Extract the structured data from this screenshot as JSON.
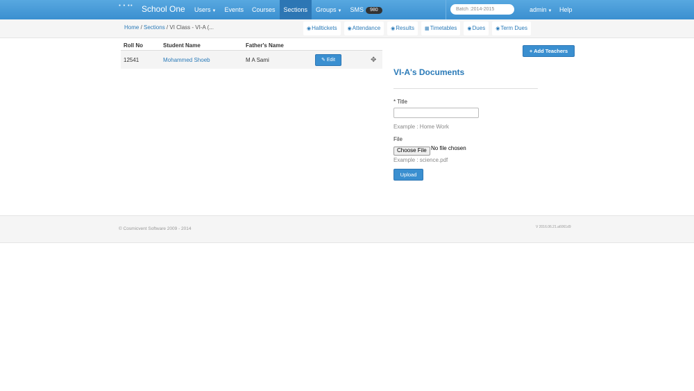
{
  "navbar": {
    "brand": "School One",
    "items": [
      {
        "label": "Users",
        "dropdown": true,
        "active": false
      },
      {
        "label": "Events",
        "dropdown": false,
        "active": false
      },
      {
        "label": "Courses",
        "dropdown": false,
        "active": false
      },
      {
        "label": "Sections",
        "dropdown": false,
        "active": true
      },
      {
        "label": "Groups",
        "dropdown": true,
        "active": false
      },
      {
        "label": "SMS",
        "dropdown": false,
        "active": false,
        "badge": "980"
      }
    ],
    "batch": "Batch :2014-2015",
    "admin": "admin",
    "help": "Help"
  },
  "breadcrumb": {
    "home": "Home",
    "sections": "Sections",
    "current": "VI Class - VI-A (..."
  },
  "subnav": [
    {
      "label": "Halltickets",
      "icon": "eye-icon"
    },
    {
      "label": "Attendance",
      "icon": "eye-icon"
    },
    {
      "label": "Results",
      "icon": "eye-icon"
    },
    {
      "label": "Timetables",
      "icon": "calendar-icon"
    },
    {
      "label": "Dues",
      "icon": "eye-icon"
    },
    {
      "label": "Term Dues",
      "icon": "eye-icon"
    }
  ],
  "table": {
    "columns": [
      "Roll No",
      "Student Name",
      "Father's Name"
    ],
    "rows": [
      {
        "roll": "12541",
        "name": "Mohammed Shoeb",
        "father": "M A Sami",
        "edit": "Edit"
      }
    ]
  },
  "documents": {
    "add_teachers": "Add Teachers",
    "title": "VI-A's Documents",
    "title_label": "* Title",
    "title_hint": "Example : Home Work",
    "file_label": "File",
    "choose_file": "Choose File",
    "no_file": "No file chosen",
    "file_hint": "Example : science.pdf",
    "upload": "Upload"
  },
  "footer": {
    "copyright": "© Cosmicvent Software 2009 - 2014",
    "version": "V 2016.06.21.a6061d9"
  },
  "colors": {
    "primary": "#3a8fd0",
    "navbar": "#58a8e0",
    "link": "#2a7ab8"
  }
}
